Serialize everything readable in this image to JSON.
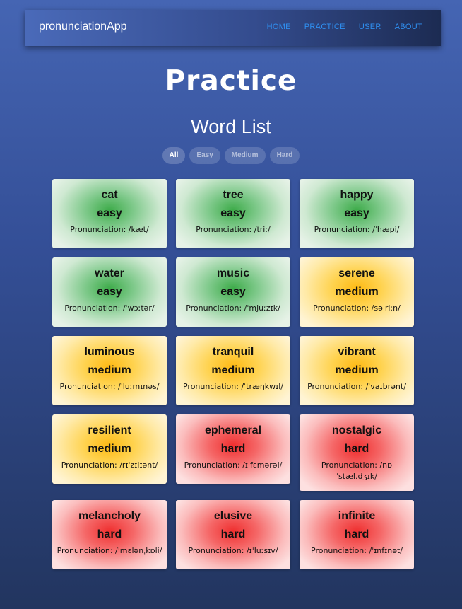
{
  "navbar": {
    "brand": "pronunciationApp",
    "links": [
      "HOME",
      "PRACTICE",
      "USER",
      "ABOUT"
    ]
  },
  "page_title": "Practice",
  "list_title": "Word List",
  "filters": [
    "All",
    "Easy",
    "Medium",
    "Hard"
  ],
  "active_filter": "All",
  "pron_prefix": "Pronunciation: ",
  "colors": {
    "easy": "#3dab49",
    "medium": "#fdb914",
    "hard": "#ef2f2f",
    "nav_link": "#2f8ff0"
  },
  "words": [
    {
      "word": "cat",
      "level": "easy",
      "pron": "/kæt/"
    },
    {
      "word": "tree",
      "level": "easy",
      "pron": "/triː/"
    },
    {
      "word": "happy",
      "level": "easy",
      "pron": "/ˈhæpi/"
    },
    {
      "word": "water",
      "level": "easy",
      "pron": "/ˈwɔːtər/"
    },
    {
      "word": "music",
      "level": "easy",
      "pron": "/ˈmjuːzɪk/"
    },
    {
      "word": "serene",
      "level": "medium",
      "pron": "/səˈriːn/"
    },
    {
      "word": "luminous",
      "level": "medium",
      "pron": "/ˈluːmɪnəs/"
    },
    {
      "word": "tranquil",
      "level": "medium",
      "pron": "/ˈtræŋkwɪl/"
    },
    {
      "word": "vibrant",
      "level": "medium",
      "pron": "/ˈvaɪbrənt/"
    },
    {
      "word": "resilient",
      "level": "medium",
      "pron": "/rɪˈzɪlɪənt/"
    },
    {
      "word": "ephemeral",
      "level": "hard",
      "pron": "/ɪˈfɛmərəl/"
    },
    {
      "word": "nostalgic",
      "level": "hard",
      "pron": "/nɒˈstæl.dʒɪk/"
    },
    {
      "word": "melancholy",
      "level": "hard",
      "pron": "/ˈmɛlənˌkɒli/"
    },
    {
      "word": "elusive",
      "level": "hard",
      "pron": "/ɪˈluːsɪv/"
    },
    {
      "word": "infinite",
      "level": "hard",
      "pron": "/ˈɪnfɪnət/"
    }
  ]
}
